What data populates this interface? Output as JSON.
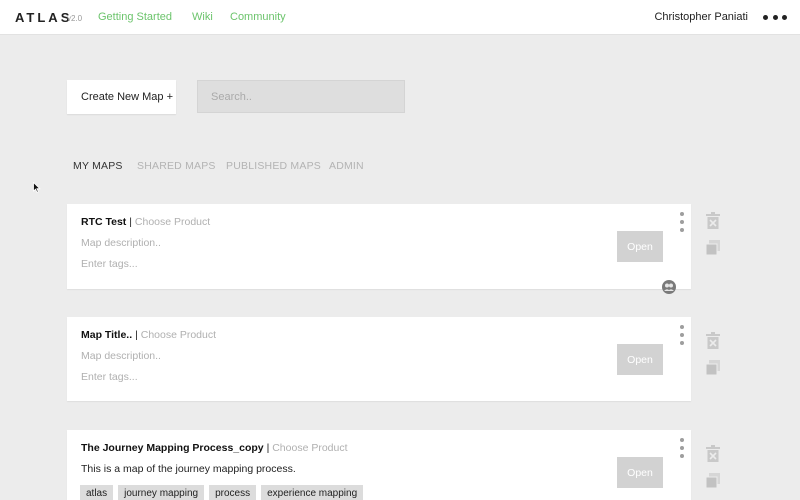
{
  "app": {
    "logo": "ATLAS",
    "version": "v2.0",
    "nav": [
      "Getting Started",
      "Wiki",
      "Community"
    ],
    "user": "Christopher Paniati"
  },
  "toolbar": {
    "create_label": "Create New Map +",
    "search_placeholder": "Search.."
  },
  "tabs": [
    "MY MAPS",
    "SHARED MAPS",
    "PUBLISHED MAPS",
    "ADMIN"
  ],
  "maps": [
    {
      "title": "RTC Test",
      "separator": "|",
      "product": "Choose Product",
      "description": "Map description..",
      "tags_placeholder": "Enter tags...",
      "open_label": "Open"
    },
    {
      "title": "Map Title..",
      "separator": "|",
      "product": "Choose Product",
      "description": "Map description..",
      "tags_placeholder": "Enter tags...",
      "open_label": "Open"
    },
    {
      "title": "The Journey Mapping Process_copy",
      "separator": "|",
      "product": "Choose Product",
      "description": "This is a map of the journey mapping process.",
      "tags": [
        "atlas",
        "journey mapping",
        "process",
        "experience mapping"
      ],
      "open_label": "Open"
    }
  ],
  "colors": {
    "accent": "#6cc46c",
    "background": "#ececec",
    "card": "#ffffff",
    "muted": "#b0b0b0",
    "button_disabled": "#d2d2d2"
  },
  "icons": {
    "more": "more-horizontal-icon",
    "card_menu": "kebab-vertical-icon",
    "delete": "trash-icon",
    "duplicate": "copy-icon",
    "collaborators": "group-avatar-icon",
    "pointer": "mouse-cursor-icon"
  }
}
